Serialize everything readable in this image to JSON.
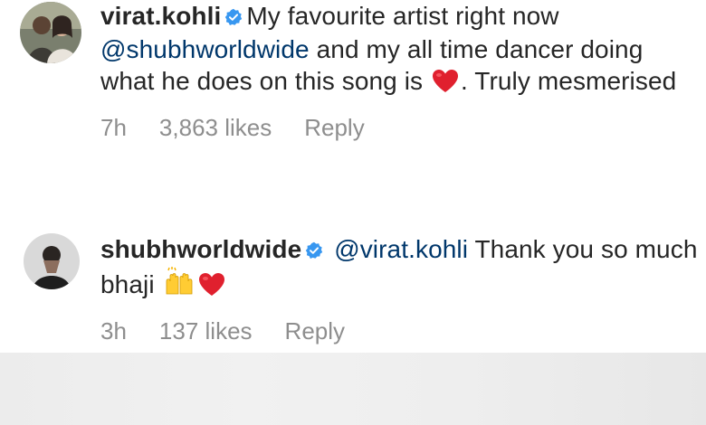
{
  "comments": [
    {
      "username": "virat.kohli",
      "verified": true,
      "text_before_mention": "My favourite artist right now",
      "mention": "@shubhworldwide",
      "text_after_mention": "and my all time dancer doing what he does on this song is",
      "emoji_1": "red-heart-emoji",
      "text_after_emoji": ". Truly mesmerised",
      "time": "7h",
      "likes": "3,863 likes",
      "reply_label": "Reply"
    },
    {
      "username": "shubhworldwide",
      "verified": true,
      "mention": "@virat.kohli",
      "text_after_mention": "Thank you so much bhaji",
      "emoji_1": "raising-hands-emoji",
      "emoji_2": "red-heart-emoji",
      "time": "3h",
      "likes": "137 likes",
      "reply_label": "Reply"
    }
  ],
  "colors": {
    "text": "#262626",
    "mention": "#00376b",
    "meta": "#8e8e8e",
    "verified_badge": "#3897f0",
    "heart": "#e0202e"
  }
}
